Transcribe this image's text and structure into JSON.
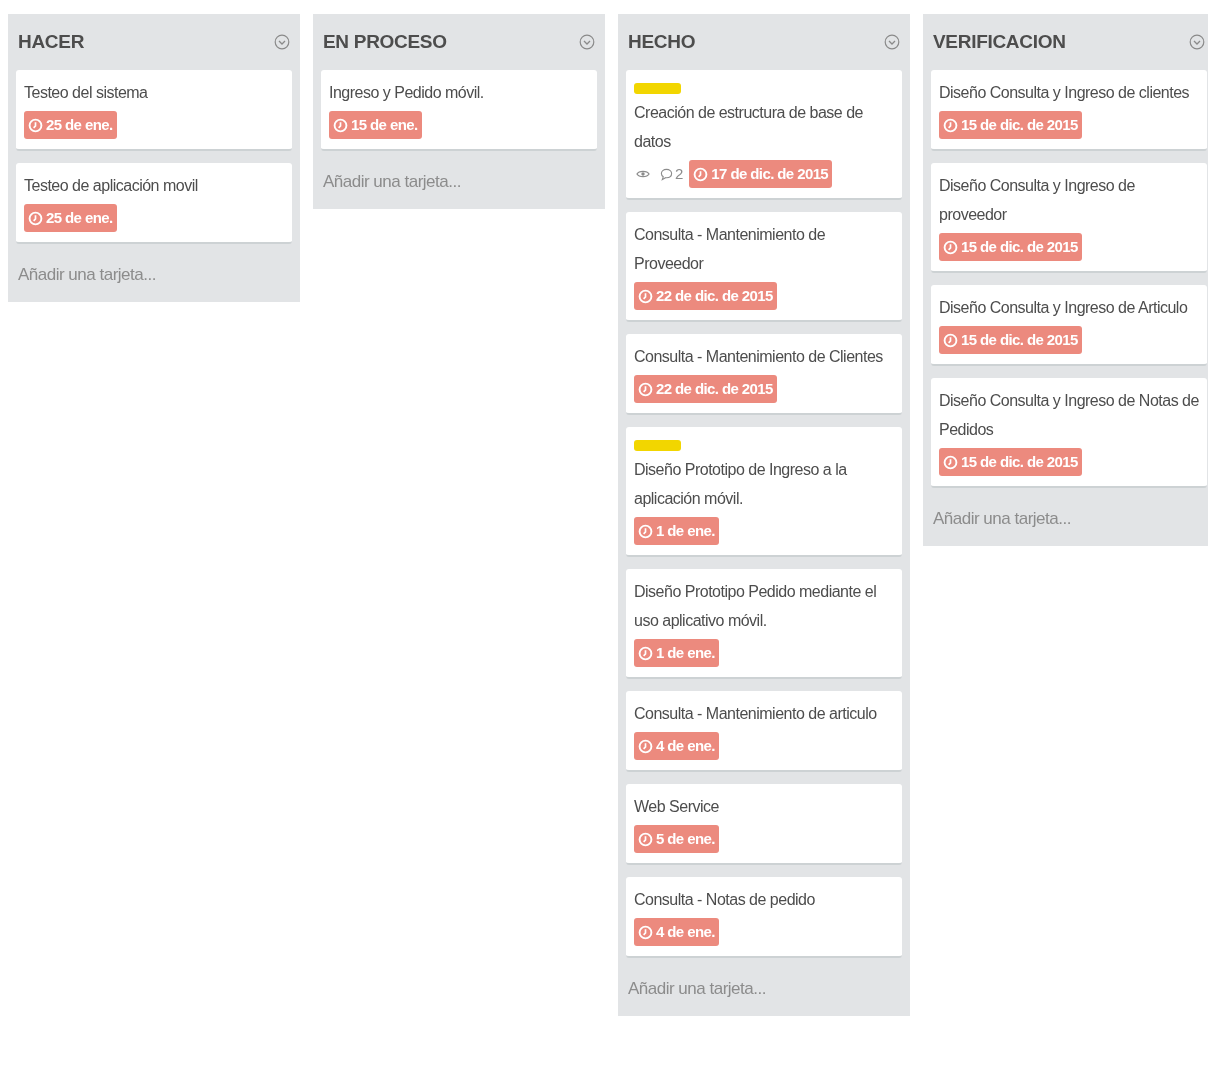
{
  "lists": [
    {
      "title": "HACER",
      "add_card": "Añadir una tarjeta...",
      "cards": [
        {
          "title": "Testeo del sistema",
          "due": "25 de ene."
        },
        {
          "title": "Testeo de aplicación movil",
          "due": "25 de ene."
        }
      ]
    },
    {
      "title": "EN PROCESO",
      "add_card": "Añadir una tarjeta...",
      "cards": [
        {
          "title": "Ingreso y Pedido móvil.",
          "due": "15 de ene."
        }
      ]
    },
    {
      "title": "HECHO",
      "add_card": "Añadir una tarjeta...",
      "cards": [
        {
          "labels": [
            {
              "color": "#f2d600"
            }
          ],
          "title": "Creación de estructura de base de datos",
          "watching": true,
          "comments": "2",
          "due": "17 de dic. de 2015"
        },
        {
          "title": "Consulta - Mantenimiento de Proveedor",
          "due": "22 de dic. de 2015"
        },
        {
          "title": "Consulta - Mantenimiento de Clientes",
          "due": "22 de dic. de 2015"
        },
        {
          "labels": [
            {
              "color": "#f2d600"
            }
          ],
          "title": "Diseño Prototipo de Ingreso a la aplicación móvil.",
          "due": "1 de ene."
        },
        {
          "title": "Diseño Prototipo Pedido mediante el uso aplicativo móvil.",
          "due": "1 de ene."
        },
        {
          "title": "Consulta - Mantenimiento de articulo",
          "due": "4 de ene."
        },
        {
          "title": "Web Service",
          "due": "5 de ene."
        },
        {
          "title": "Consulta - Notas de pedido",
          "due": "4 de ene."
        }
      ]
    },
    {
      "title": "VERIFICACION",
      "add_card": "Añadir una tarjeta...",
      "cards": [
        {
          "title": "Diseño Consulta y Ingreso de clientes",
          "due": "15 de dic. de 2015"
        },
        {
          "title": "Diseño Consulta y Ingreso de proveedor",
          "due": "15 de dic. de 2015"
        },
        {
          "title": "Diseño Consulta y Ingreso de Articulo",
          "due": "15 de dic. de 2015"
        },
        {
          "title": "Diseño Consulta y Ingreso de Notas de Pedidos",
          "due": "15 de dic. de 2015"
        }
      ]
    }
  ]
}
